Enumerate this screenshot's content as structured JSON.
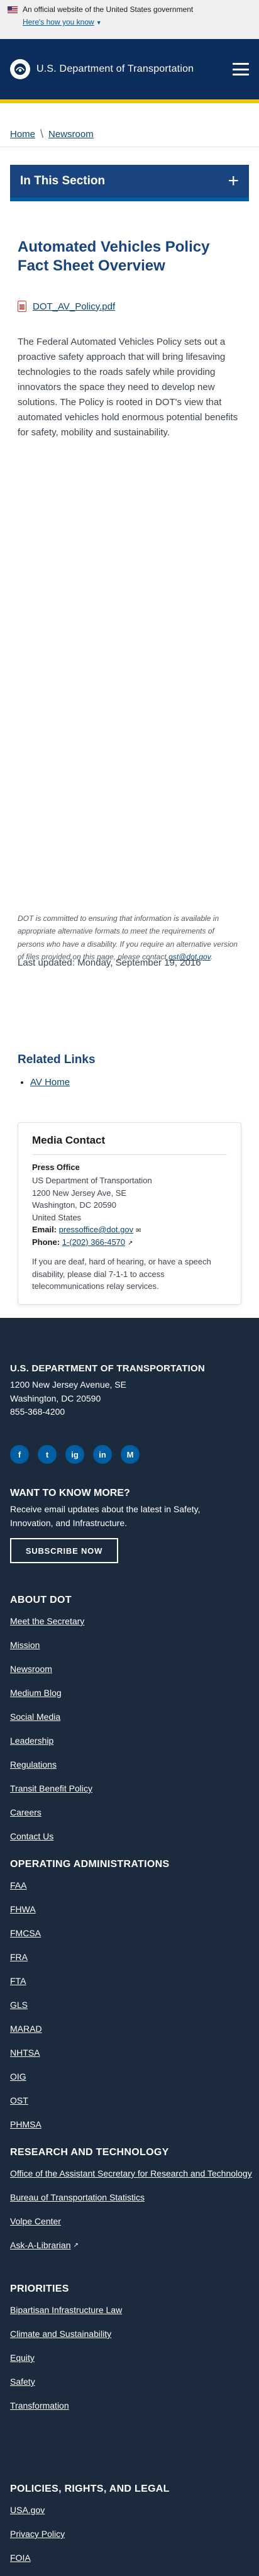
{
  "gov_banner": {
    "official_text": "An official website of the United States government",
    "know_link": "Here's how you know"
  },
  "header": {
    "brand_name": "U.S. Department of Transportation"
  },
  "breadcrumb": [
    "Home",
    "Newsroom"
  ],
  "section_nav": {
    "title": "In This Section"
  },
  "page": {
    "title": "Automated Vehicles Policy Fact Sheet Overview",
    "document_link": "DOT_AV_Policy.pdf",
    "intro": "The Federal Automated Vehicles Policy sets out a proactive safety approach that will bring lifesaving technologies to the roads safely while providing innovators the space they need to develop new solutions. The Policy is rooted in DOT's view that automated vehicles hold enormous potential benefits for safety, mobility and sustainability.",
    "access_note_text": "DOT is committed to ensuring that information is available in appropriate alternative formats to meet the requirements of persons who have a disability. If you require an alternative version of files provided on this page, please contact",
    "access_note_link": "ost@dot.gov",
    "access_note_end": ".",
    "last_updated": "Last updated: Monday, September 19, 2016"
  },
  "related_links": {
    "title": "Related Links",
    "items": [
      "AV Home"
    ]
  },
  "media_contact": {
    "title": "Media Contact",
    "office": "Press Office",
    "address_lines": [
      "US Department of Transportation",
      "1200 New Jersey Ave, SE",
      "Washington, DC 20590",
      "United States"
    ],
    "email_label": "Email:",
    "email": "pressoffice@dot.gov",
    "phone_label": "Phone:",
    "phone": "1-(202) 366-4570",
    "note": "If you are deaf, hard of hearing, or have a speech disability, please dial 7-1-1 to access telecommunications relay services."
  },
  "footer": {
    "org": "U.S. DEPARTMENT OF TRANSPORTATION",
    "address_lines": [
      "1200 New Jersey Avenue, SE",
      "Washington, DC 20590",
      "855-368-4200"
    ],
    "social": [
      "f",
      "t",
      "ig",
      "in",
      "M"
    ],
    "want_title": "WANT TO KNOW MORE?",
    "want_text": "Receive email updates about the latest in Safety, Innovation, and Infrastructure.",
    "subscribe_label": "SUBSCRIBE NOW",
    "about": {
      "title": "ABOUT DOT",
      "items": [
        "Meet the Secretary",
        "Mission",
        "Newsroom",
        "Medium Blog",
        "Social Media",
        "Leadership",
        "Regulations",
        "Transit Benefit Policy",
        "Careers",
        "Contact Us"
      ]
    },
    "operating": {
      "title": "OPERATING ADMINISTRATIONS",
      "items": [
        "FAA",
        "FHWA",
        "FMCSA",
        "FRA",
        "FTA",
        "GLS",
        "MARAD",
        "NHTSA",
        "OIG",
        "OST",
        "PHMSA"
      ]
    },
    "research": {
      "title": "RESEARCH AND TECHNOLOGY",
      "items": [
        "Office of the Assistant Secretary for Research and Technology",
        "Bureau of Transportation Statistics",
        "Volpe Center",
        "Ask-A-Librarian"
      ]
    },
    "priorities": {
      "title": "PRIORITIES",
      "items": [
        "Bipartisan Infrastructure Law",
        "Climate and Sustainability",
        "Equity",
        "Safety",
        "Transformation"
      ]
    },
    "policies": {
      "title": "POLICIES, RIGHTS, AND LEGAL",
      "items": [
        "USA.gov",
        "Privacy Policy",
        "FOIA"
      ]
    }
  }
}
